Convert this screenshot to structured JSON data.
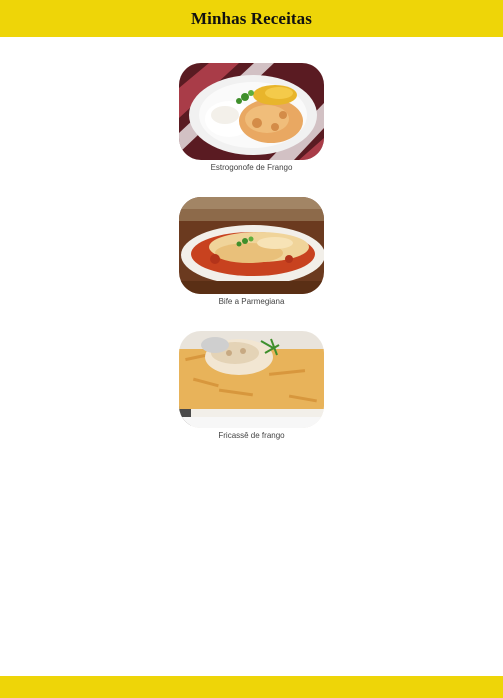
{
  "header": {
    "title": "Minhas Receitas"
  },
  "recipes": [
    {
      "name": "Estrogonofe de Frango",
      "image_icon": "strogonoff-dish-icon"
    },
    {
      "name": "Bife a Parmegiana",
      "image_icon": "parmigiana-dish-icon"
    },
    {
      "name": "Fricassê de frango",
      "image_icon": "fricasse-dish-icon"
    }
  ],
  "colors": {
    "header_bg": "#eed508",
    "footer_bg": "#eed508",
    "page_bg": "#ffffff"
  }
}
